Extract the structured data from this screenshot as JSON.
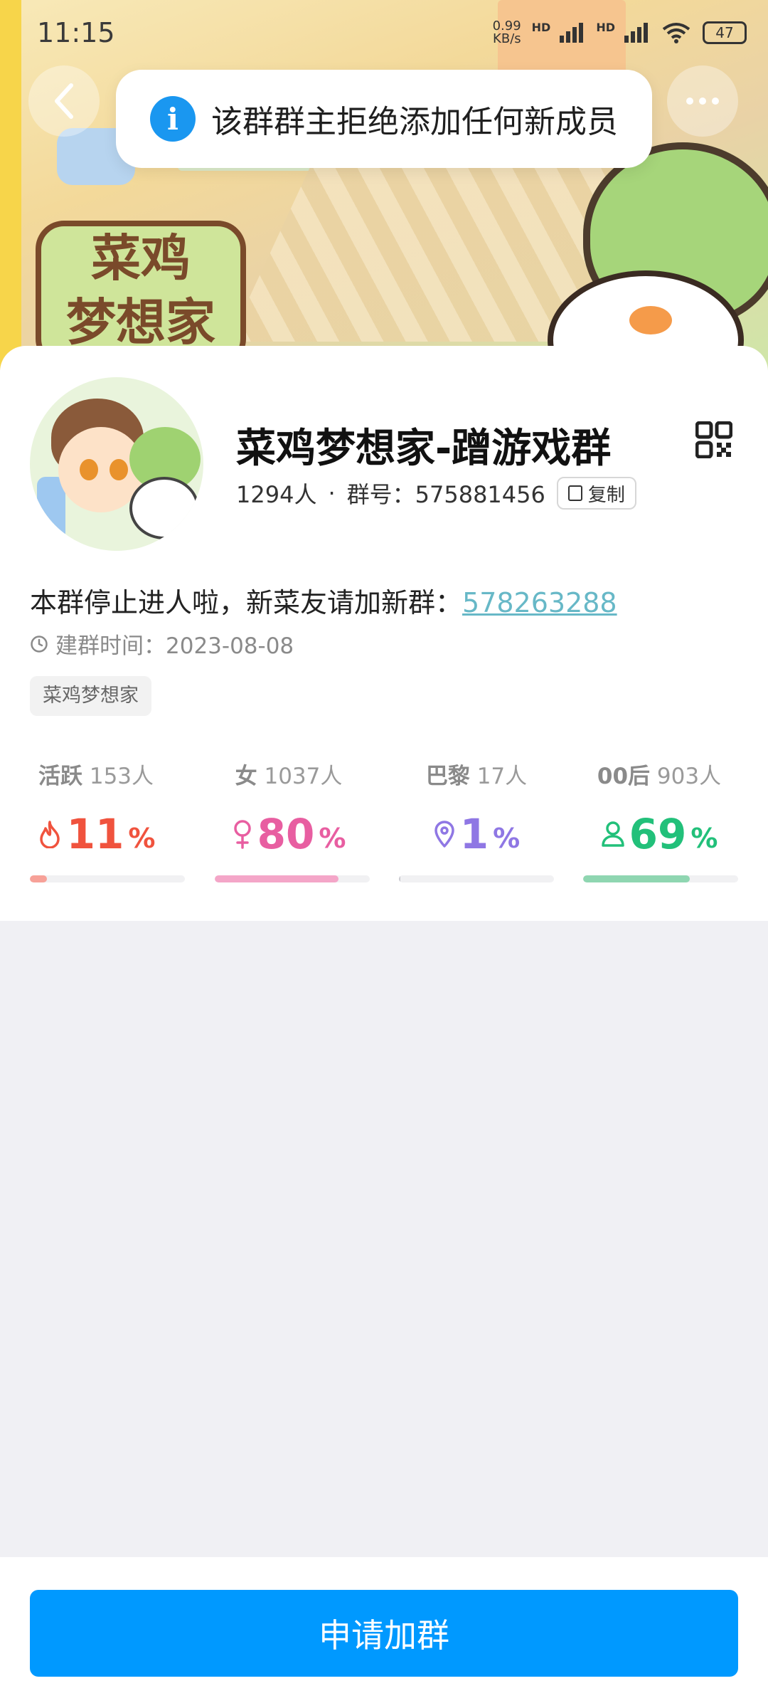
{
  "status_bar": {
    "time": "11:15",
    "net_speed_value": "0.99",
    "net_speed_unit": "KB/s",
    "hd1": "HD",
    "hd2": "HD",
    "battery": "47"
  },
  "toast": {
    "icon": "info-icon",
    "text": "该群群主拒绝添加任何新成员"
  },
  "banner": {
    "logo_text": "菜鸡 梦想家"
  },
  "group": {
    "name": "菜鸡梦想家-蹭游戏群",
    "member_count": "1294人",
    "separator": "·",
    "group_id_label": "群号：575881456",
    "copy_label": "复制",
    "notice_text": "本群停止进人啦，新菜友请加新群：",
    "notice_link": "578263288",
    "created_label": "建群时间：2023-08-08",
    "tag": "菜鸡梦想家"
  },
  "stats": [
    {
      "label": "活跃",
      "count": "153人",
      "value": "11",
      "unit": "%",
      "icon": "flame-icon",
      "color": "#f0533e",
      "fill_percent": 11
    },
    {
      "label": "女",
      "count": "1037人",
      "value": "80",
      "unit": "%",
      "icon": "female-icon",
      "color": "#e85ea1",
      "fill_percent": 80
    },
    {
      "label": "巴黎",
      "count": "17人",
      "value": "1",
      "unit": "%",
      "icon": "location-pin-icon",
      "color": "#8f77e4",
      "fill_percent": 1
    },
    {
      "label": "00后",
      "count": "903人",
      "value": "69",
      "unit": "%",
      "icon": "person-icon",
      "color": "#22c07a",
      "fill_percent": 69
    }
  ],
  "bar_colors": [
    "#f7a198",
    "#f4a6c8",
    "#c9c9cf",
    "#8fd6b1"
  ],
  "join_button": "申请加群",
  "colors": {
    "primary": "#0099ff",
    "link": "#67b8c7",
    "background": "#f0f0f4"
  }
}
